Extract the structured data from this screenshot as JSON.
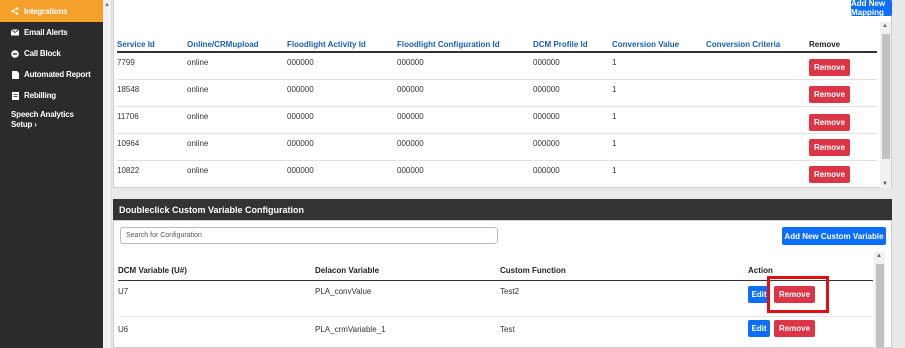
{
  "sidebar": {
    "items": [
      {
        "label": "Integrations",
        "icon": "share-icon",
        "active": true
      },
      {
        "label": "Email Alerts",
        "icon": "envelope-icon"
      },
      {
        "label": "Call Block",
        "icon": "block-icon"
      },
      {
        "label": "Automated Report",
        "icon": "document-icon"
      },
      {
        "label": "Rebilling",
        "icon": "invoice-icon"
      },
      {
        "label": "Speech Analytics Setup ›",
        "icon": ""
      }
    ]
  },
  "mapping": {
    "add_label": "Add New Mapping",
    "headers": [
      "Service Id",
      "Online/CRMupload",
      "Floodlight Activity Id",
      "Floodlight Configuration Id",
      "DCM Profile Id",
      "Conversion Value",
      "Conversion Criteria",
      "Remove"
    ],
    "rows": [
      [
        "7799",
        "online",
        "000000",
        "000000",
        "000000",
        "1",
        ""
      ],
      [
        "18548",
        "online",
        "000000",
        "000000",
        "000000",
        "1",
        ""
      ],
      [
        "11706",
        "online",
        "000000",
        "000000",
        "000000",
        "1",
        ""
      ],
      [
        "10964",
        "online",
        "000000",
        "000000",
        "000000",
        "1",
        ""
      ],
      [
        "10822",
        "online",
        "000000",
        "000000",
        "000000",
        "1",
        ""
      ]
    ],
    "remove_label": "Remove"
  },
  "custom_var": {
    "title": "Doubleclick Custom Variable Configuration",
    "search_placeholder": "Search for Configuration",
    "add_label": "Add New Custom Variable",
    "headers": [
      "DCM Variable (U#)",
      "Delacon Variable",
      "Custom Function",
      "Action"
    ],
    "rows": [
      [
        "U7",
        "PLA_convValue",
        "Test2"
      ],
      [
        "U6",
        "PLA_crmVariable_1",
        "Test"
      ]
    ],
    "edit_label": "Edit",
    "remove_label": "Remove"
  },
  "colors": {
    "accent": "#f5a02a",
    "primary": "#0d6efd",
    "danger": "#dc3545",
    "header_link": "#1a5fb4"
  }
}
